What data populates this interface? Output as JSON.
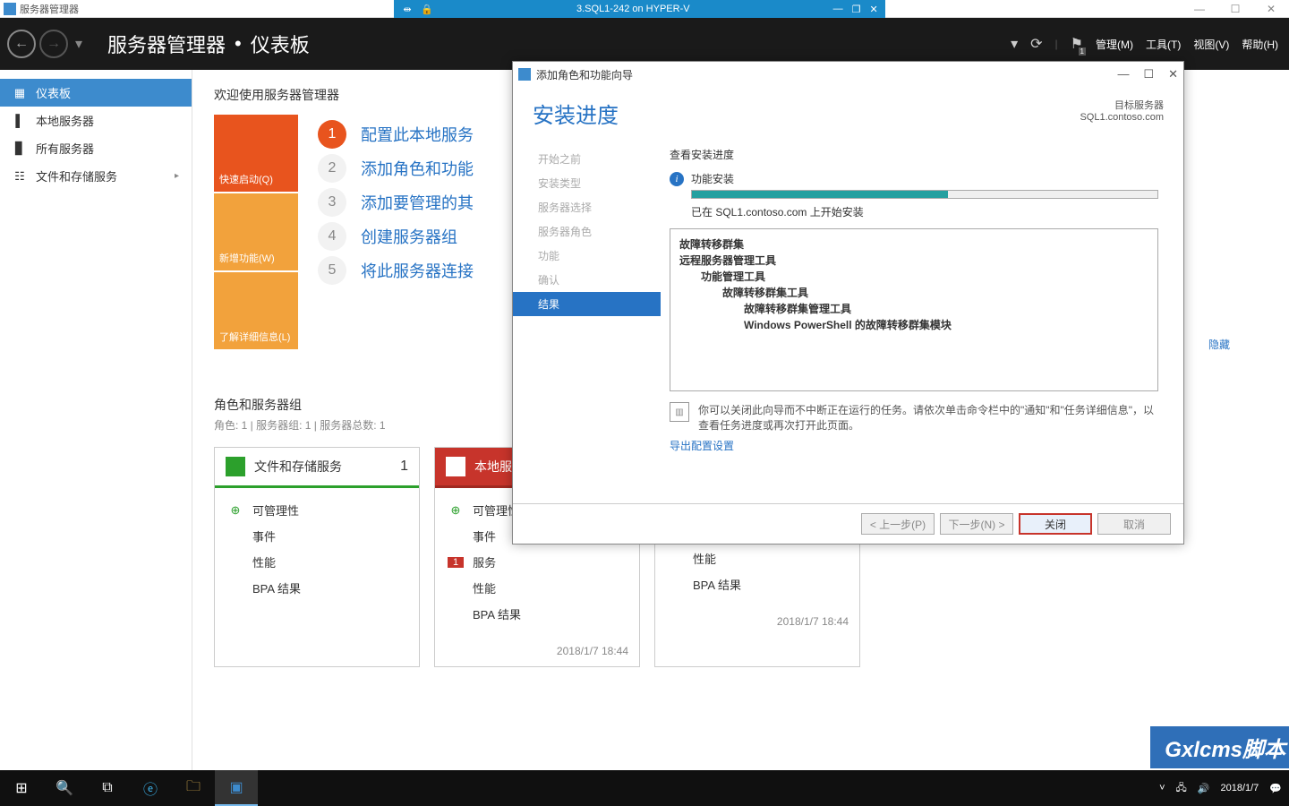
{
  "outer": {
    "title": "服务器管理器"
  },
  "vm": {
    "name": "3.SQL1-242 on HYPER-V"
  },
  "header": {
    "breadcrumb_a": "服务器管理器",
    "breadcrumb_b": "仪表板",
    "menu_manage": "管理(M)",
    "menu_tools": "工具(T)",
    "menu_view": "视图(V)",
    "menu_help": "帮助(H)",
    "flag_badge": "1"
  },
  "sidebar": {
    "items": [
      {
        "label": "仪表板"
      },
      {
        "label": "本地服务器"
      },
      {
        "label": "所有服务器"
      },
      {
        "label": "文件和存储服务"
      }
    ]
  },
  "main": {
    "welcome": "欢迎使用服务器管理器",
    "tiles": {
      "quick": "快速启动(Q)",
      "whatsnew": "新增功能(W)",
      "learn": "了解详细信息(L)"
    },
    "steps": [
      "配置此本地服务",
      "添加角色和功能",
      "添加要管理的其",
      "创建服务器组",
      "将此服务器连接"
    ],
    "hide_label": "隐藏",
    "groups_title": "角色和服务器组",
    "groups_sub": "角色: 1 | 服务器组: 1 | 服务器总数: 1",
    "cards": [
      {
        "title": "文件和存储服务",
        "count": "1",
        "rows": [
          "可管理性",
          "事件",
          "性能",
          "BPA 结果"
        ],
        "foot": ""
      },
      {
        "title": "本地服",
        "count": "",
        "rows": [
          "可管理性",
          "事件",
          "服务",
          "性能",
          "BPA 结果"
        ],
        "alert": "1",
        "foot": "2018/1/7 18:44"
      },
      {
        "title": "",
        "count": "",
        "rows": [
          "性能",
          "BPA 结果"
        ],
        "foot": "2018/1/7 18:44"
      }
    ]
  },
  "wizard": {
    "window_title": "添加角色和功能向导",
    "title": "安装进度",
    "target_label": "目标服务器",
    "target_server": "SQL1.contoso.com",
    "steps": [
      "开始之前",
      "安装类型",
      "服务器选择",
      "服务器角色",
      "功能",
      "确认",
      "结果"
    ],
    "content": {
      "view_progress": "查看安装进度",
      "status": "功能安装",
      "message": "已在 SQL1.contoso.com 上开始安装",
      "tree": [
        "故障转移群集",
        "远程服务器管理工具",
        "功能管理工具",
        "故障转移群集工具",
        "故障转移群集管理工具",
        "Windows PowerShell 的故障转移群集模块"
      ],
      "hint": "你可以关闭此向导而不中断正在运行的任务。请依次单击命令栏中的\"通知\"和\"任务详细信息\"，以查看任务进度或再次打开此页面。",
      "export_link": "导出配置设置"
    },
    "buttons": {
      "prev": "< 上一步(P)",
      "next": "下一步(N) >",
      "close": "关闭",
      "cancel": "取消"
    }
  },
  "taskbar": {
    "date": "2018/1/7"
  },
  "watermark": "Gxlcms脚本"
}
